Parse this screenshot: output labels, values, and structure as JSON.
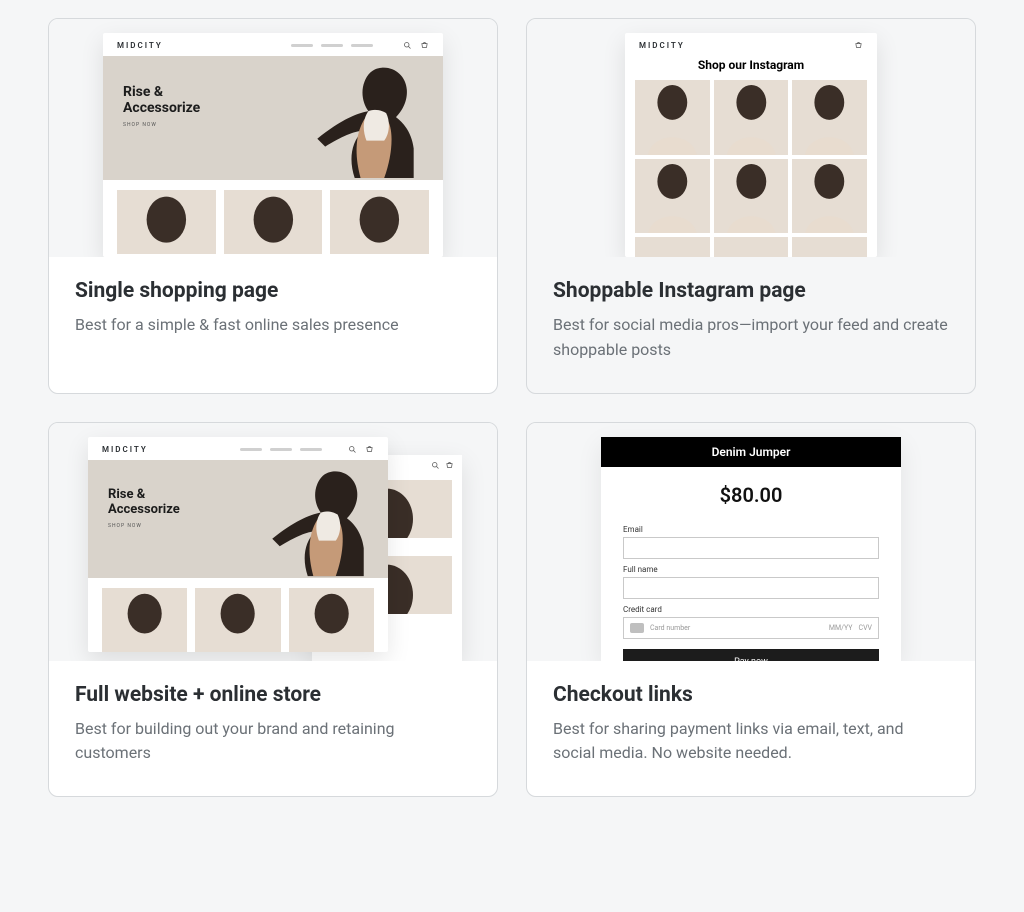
{
  "preview_brand": "MIDCITY",
  "preview_hero_line1": "Rise &",
  "preview_hero_line2": "Accessorize",
  "preview_hero_cta": "SHOP NOW",
  "preview_ig_title": "Shop our Instagram",
  "checkout": {
    "product": "Denim Jumper",
    "price": "$80.00",
    "label_email": "Email",
    "label_name": "Full name",
    "label_card": "Credit card",
    "placeholder_card": "Card number",
    "placeholder_exp": "MM/YY",
    "placeholder_cvv": "CVV",
    "pay_button": "Pay now"
  },
  "cards": [
    {
      "title": "Single shopping page",
      "desc": "Best for a simple & fast online sales presence"
    },
    {
      "title": "Shoppable Instagram page",
      "desc": "Best for social media pros—import your feed and create shoppable posts"
    },
    {
      "title": "Full website + online store",
      "desc": "Best for building out your brand and retaining customers"
    },
    {
      "title": "Checkout links",
      "desc": "Best for sharing payment links via email, text, and social media. No website needed."
    }
  ]
}
